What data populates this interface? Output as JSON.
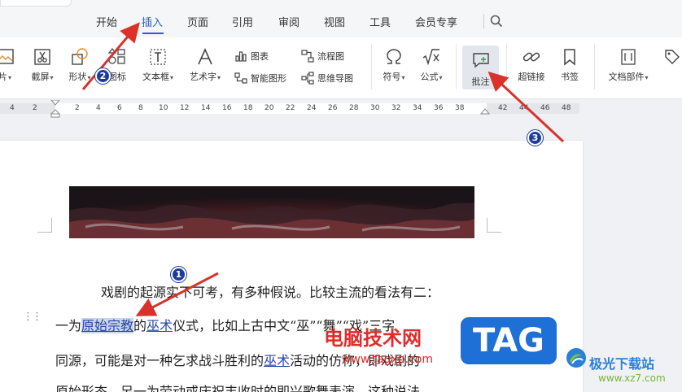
{
  "tabs": [
    {
      "label": "开始",
      "active": false
    },
    {
      "label": "插入",
      "active": true
    },
    {
      "label": "页面",
      "active": false
    },
    {
      "label": "引用",
      "active": false
    },
    {
      "label": "审阅",
      "active": false
    },
    {
      "label": "视图",
      "active": false
    },
    {
      "label": "工具",
      "active": false
    },
    {
      "label": "会员专享",
      "active": false
    }
  ],
  "ribbon": {
    "picture": "片",
    "screenshot": "截屏",
    "shapes": "形状",
    "icons": "图标",
    "textbox": "文本框",
    "wordart": "艺术字",
    "chart": "图表",
    "smartart": "智能图形",
    "flowchart": "流程图",
    "mindmap": "思维导图",
    "symbol": "符号",
    "formula": "公式",
    "comment": "批注",
    "hyperlink": "超链接",
    "bookmark": "书签",
    "docparts": "文档部件"
  },
  "ruler_ticks": [
    "4",
    "2",
    "2",
    "4",
    "6",
    "8",
    "10",
    "12",
    "14",
    "16",
    "18",
    "20",
    "22",
    "24",
    "26",
    "28",
    "30",
    "32",
    "34",
    "36",
    "38",
    "42",
    "44",
    "46",
    "48"
  ],
  "document": {
    "line1": "戏剧的起源实不可考，有多种假说。比较主流的看法有二：",
    "line2_a": "一为",
    "line2_hl": "原始宗教",
    "line2_b": "的",
    "line2_link": "巫术",
    "line2_c": "仪式，比如上古中文“巫”“舞”“戏”三字",
    "line3_a": "同源，可能是对一种乞求战斗胜利的",
    "line3_link": "巫术",
    "line3_b": "活动的仿称，即戏剧的",
    "line4": "原始形态。另一为劳动或庆祝丰收时的即兴歌舞表演，这种说法"
  },
  "annotations": {
    "step1": "1",
    "step2": "2",
    "step3": "3"
  },
  "watermark": {
    "site_name": "电脑技术网",
    "site_url": "www.tagxp.com",
    "tag": "TAG",
    "logo_name": "极光下载站",
    "logo_url": "www.xz7.com"
  },
  "colors": {
    "accent": "#2b5dd8",
    "arrow": "#d9322b",
    "badge": "#1d3c9c"
  }
}
